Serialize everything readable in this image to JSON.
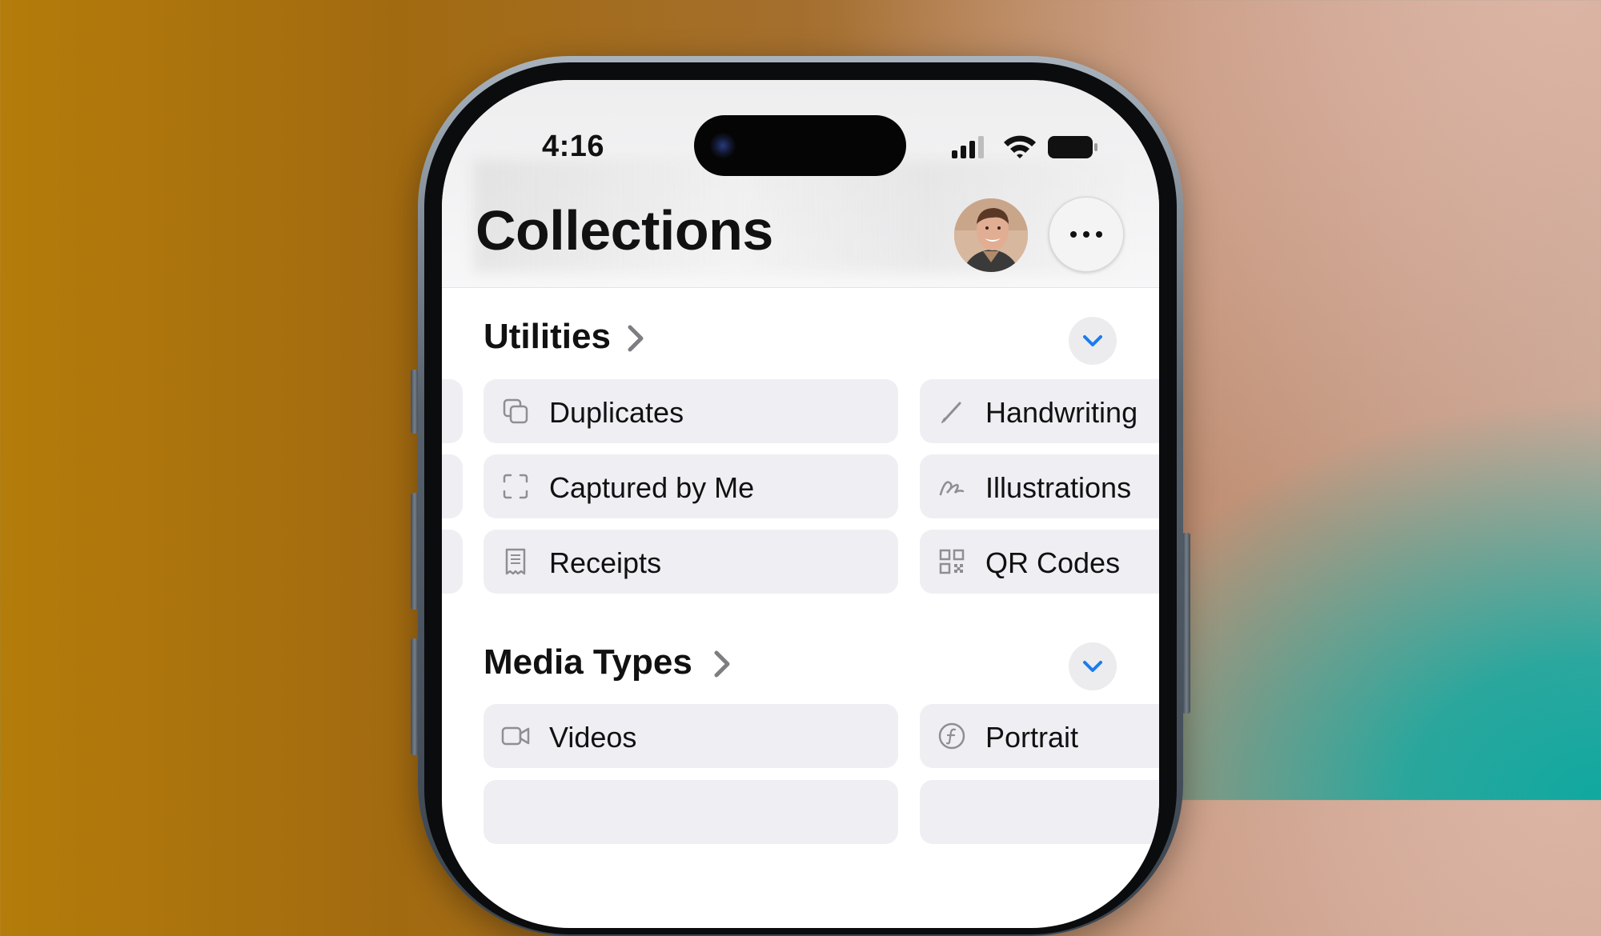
{
  "status_bar": {
    "time": "4:16"
  },
  "header": {
    "title": "Collections"
  },
  "sections": [
    {
      "title": "Utilities",
      "items": [
        {
          "label": "Duplicates",
          "icon": "duplicates-icon"
        },
        {
          "label": "Handwriting",
          "icon": "pencil-icon"
        },
        {
          "label": "Captured by Me",
          "icon": "viewfinder-icon"
        },
        {
          "label": "Illustrations",
          "icon": "scribble-icon"
        },
        {
          "label": "Receipts",
          "icon": "receipt-icon"
        },
        {
          "label": "QR Codes",
          "icon": "qr-code-icon"
        }
      ]
    },
    {
      "title": "Media Types",
      "items": [
        {
          "label": "Videos",
          "icon": "video-icon"
        },
        {
          "label": "Portrait",
          "icon": "portrait-f-icon"
        }
      ]
    }
  ],
  "colors": {
    "accent": "#1a7cf0",
    "tile": "#efeff3",
    "collapse_button": "#ececee"
  }
}
